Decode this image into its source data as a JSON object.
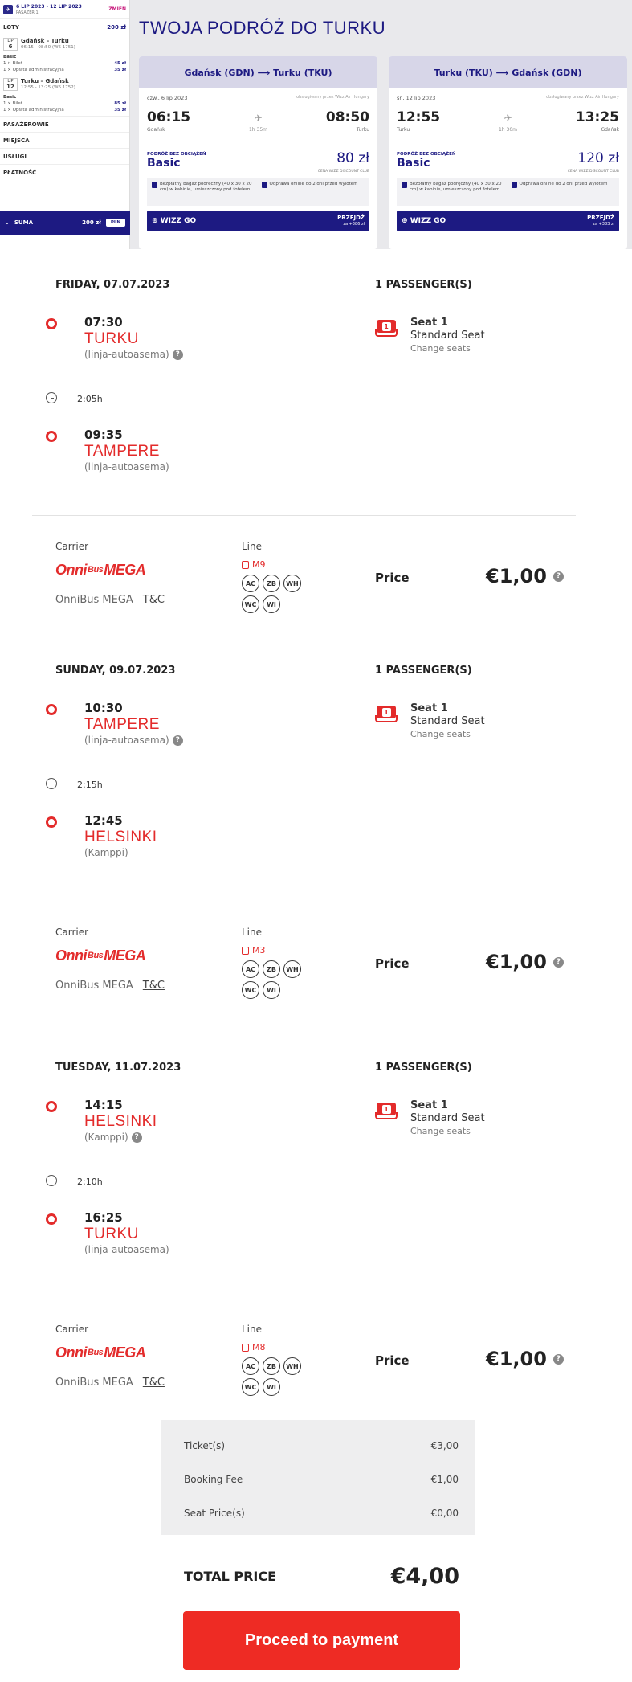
{
  "sidebar": {
    "dates": "6 LIP 2023 - 12 LIP 2023",
    "passengers": "PASAŻER 1",
    "change": "ZMIEŃ",
    "flights_label": "LOTY",
    "flights_total": "200 zł",
    "legs": [
      {
        "month": "LIP",
        "day": "6",
        "route": "Gdańsk – Turku",
        "time": "06:15 - 08:50 (W6 1751)",
        "fare": "Basic",
        "items": [
          {
            "label": "1 × Bilet",
            "price": "45 zł"
          },
          {
            "label": "1 × Opłata administracyjna",
            "price": "35 zł"
          }
        ]
      },
      {
        "month": "LIP",
        "day": "12",
        "route": "Turku – Gdańsk",
        "time": "12:55 - 13:25 (W6 1752)",
        "fare": "Basic",
        "items": [
          {
            "label": "1 × Bilet",
            "price": "85 zł"
          },
          {
            "label": "1 × Opłata administracyjna",
            "price": "35 zł"
          }
        ]
      }
    ],
    "menu": [
      "PASAŻEROWIE",
      "MIEJSCA",
      "USŁUGI",
      "PŁATNOŚĆ"
    ],
    "sum_label": "SUMA",
    "sum_value": "200 zł",
    "currency": "PLN"
  },
  "page_title": "TWOJA PODRÓŻ DO TURKU",
  "flights": [
    {
      "route": "Gdańsk (GDN) ⟶ Turku (TKU)",
      "date": "czw., 6 lip 2023",
      "note": "obsługiwany przez Wizz Air Hungary",
      "dep_time": "06:15",
      "arr_time": "08:50",
      "dep_city": "Gdańsk",
      "arr_city": "Turku",
      "duration": "1h 35m",
      "fare_label": "PODRÓŻ BEZ OBCIĄŻEŃ",
      "fare_name": "Basic",
      "price": "80 zł",
      "club": "CENA WIZZ DISCOUNT CLUB",
      "perk1": "Bezpłatny bagaż podręczny (40 x 30 x 20 cm) w kabinie, umieszczony pod fotelem",
      "perk2": "Odprawa online do 2 dni przed wylotem",
      "btn": "WIZZ GO",
      "go": "PRZEJDŹ",
      "go_sub": "za +386 zł"
    },
    {
      "route": "Turku (TKU) ⟶ Gdańsk (GDN)",
      "date": "śr., 12 lip 2023",
      "note": "obsługiwany przez Wizz Air Hungary",
      "dep_time": "12:55",
      "arr_time": "13:25",
      "dep_city": "Turku",
      "arr_city": "Gdańsk",
      "duration": "1h 30m",
      "fare_label": "PODRÓŻ BEZ OBCIĄŻEŃ",
      "fare_name": "Basic",
      "price": "120 zł",
      "club": "CENA WIZZ DISCOUNT CLUB",
      "perk1": "Bezpłatny bagaż podręczny (40 x 30 x 20 cm) w kabinie, umieszczony pod fotelem",
      "perk2": "Odprawa online do 2 dni przed wylotem",
      "btn": "WIZZ GO",
      "go": "PRZEJDŹ",
      "go_sub": "za +383 zł"
    }
  ],
  "segments": [
    {
      "date": "FRIDAY, 07.07.2023",
      "passengers": "1 PASSENGER(S)",
      "dep_time": "07:30",
      "dep_city": "TURKU",
      "dep_station": "(linja-autoasema)",
      "duration": "2:05h",
      "arr_time": "09:35",
      "arr_city": "TAMPERE",
      "arr_station": "(linja-autoasema)",
      "seat": "Seat 1",
      "seat_type": "Standard Seat",
      "change": "Change seats",
      "carrier_label": "Carrier",
      "carrier_name": "OnniBus MEGA",
      "tc": "T&C",
      "line_label": "Line",
      "line": "M9",
      "price_label": "Price",
      "price": "€1,00"
    },
    {
      "date": "SUNDAY, 09.07.2023",
      "passengers": "1 PASSENGER(S)",
      "dep_time": "10:30",
      "dep_city": "TAMPERE",
      "dep_station": "(linja-autoasema)",
      "duration": "2:15h",
      "arr_time": "12:45",
      "arr_city": "HELSINKI",
      "arr_station": "(Kamppi)",
      "seat": "Seat 1",
      "seat_type": "Standard Seat",
      "change": "Change seats",
      "carrier_label": "Carrier",
      "carrier_name": "OnniBus MEGA",
      "tc": "T&C",
      "line_label": "Line",
      "line": "M3",
      "price_label": "Price",
      "price": "€1,00"
    },
    {
      "date": "TUESDAY, 11.07.2023",
      "passengers": "1 PASSENGER(S)",
      "dep_time": "14:15",
      "dep_city": "HELSINKI",
      "dep_station": "(Kamppi)",
      "duration": "2:10h",
      "arr_time": "16:25",
      "arr_city": "TURKU",
      "arr_station": "(linja-autoasema)",
      "seat": "Seat 1",
      "seat_type": "Standard Seat",
      "change": "Change seats",
      "carrier_label": "Carrier",
      "carrier_name": "OnniBus MEGA",
      "tc": "T&C",
      "line_label": "Line",
      "line": "M8",
      "price_label": "Price",
      "price": "€1,00"
    }
  ],
  "amenities": [
    "AC",
    "ZB",
    "WH",
    "WC",
    "WI"
  ],
  "summary": [
    {
      "label": "Ticket(s)",
      "value": "€3,00"
    },
    {
      "label": "Booking Fee",
      "value": "€1,00"
    },
    {
      "label": "Seat Price(s)",
      "value": "€0,00"
    }
  ],
  "total_label": "TOTAL PRICE",
  "total_value": "€4,00",
  "pay_button": "Proceed to payment",
  "logo_text": {
    "a": "Onni",
    "b": "Bus",
    "c": "MEGA"
  }
}
